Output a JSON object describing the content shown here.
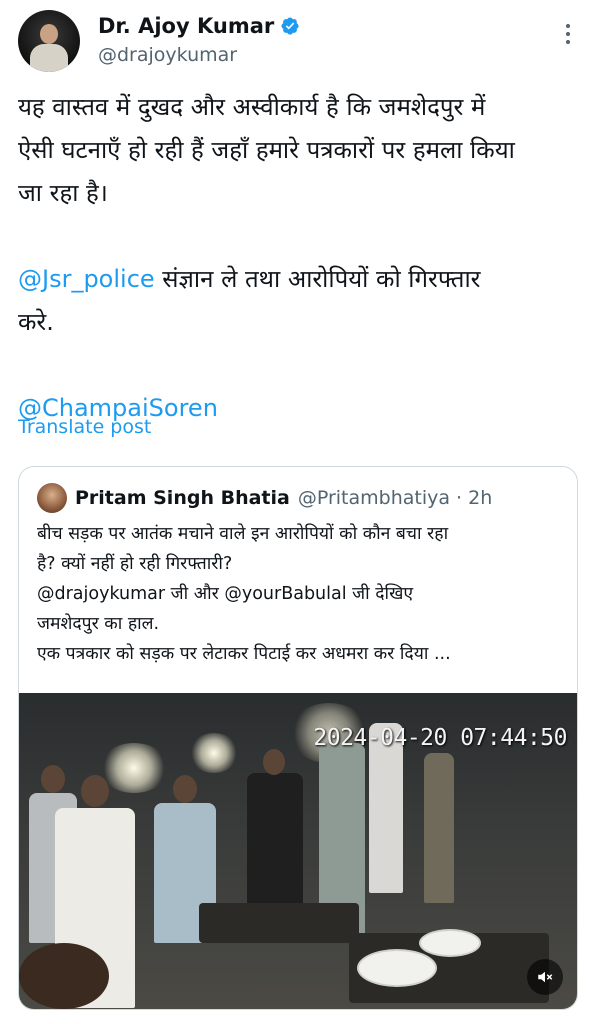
{
  "author": {
    "display_name": "Dr. Ajoy Kumar",
    "handle": "@drajoykumar",
    "verified_icon": "verified-badge-icon",
    "verified_color": "#1d9bf0"
  },
  "tweet": {
    "line1": "यह वास्तव में दुखद और अस्वीकार्य है कि जमशेदपुर में",
    "line2": "ऐसी घटनाएँ हो रही हैं जहाँ हमारे पत्रकारों पर हमला किया",
    "line3": "जा रहा है।",
    "mention1": "@Jsr_police",
    "line4_rest": " संज्ञान ले तथा आरोपियों को गिरफ्तार",
    "line5": "करे.",
    "mention2": "@ChampaiSoren"
  },
  "translate_label": "Translate post",
  "quote": {
    "display_name": "Pritam Singh Bhatia",
    "handle_time": "@Pritambhatiya · 2h",
    "line1": "बीच सड़क पर आतंक मचाने वाले इन आरोपियों को कौन बचा रहा",
    "line2": "है? क्यों नहीं हो रही गिरफ्तारी?",
    "line3": "@drajoykumar जी और @yourBabulal जी देखिए",
    "line4": "जमशेदपुर का हाल.",
    "line5": "एक पत्रकार को सड़क पर लेटाकर पिटाई कर अधमरा कर दिया ...",
    "video_timestamp": "2024-04-20 07:44:50",
    "mute_icon": "volume-mute-icon"
  },
  "colors": {
    "link": "#1d9bf0",
    "text": "#0f1419",
    "secondary": "#536471",
    "border": "#cfd9de"
  }
}
